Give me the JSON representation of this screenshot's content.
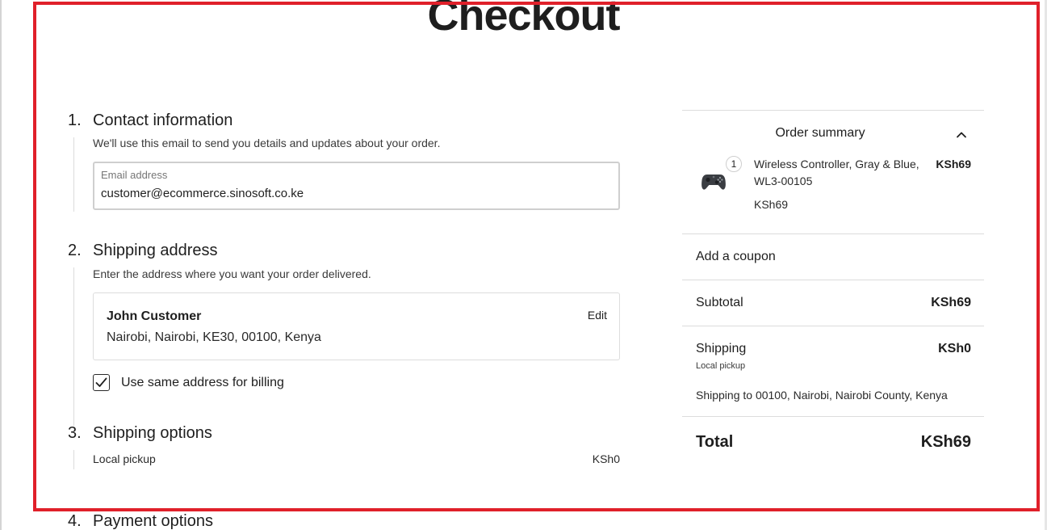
{
  "page": {
    "title": "Checkout"
  },
  "contact": {
    "number": "1.",
    "title": "Contact information",
    "description": "We'll use this email to send you details and updates about your order.",
    "email_label": "Email address",
    "email_value": "customer@ecommerce.sinosoft.co.ke"
  },
  "shipping_address": {
    "number": "2.",
    "title": "Shipping address",
    "description": "Enter the address where you want your order delivered.",
    "name": "John Customer",
    "address": "Nairobi, Nairobi, KE30, 00100, Kenya",
    "edit_label": "Edit",
    "billing_label": "Use same address for billing",
    "billing_checked": true
  },
  "shipping_options": {
    "number": "3.",
    "title": "Shipping options",
    "option_label": "Local pickup",
    "option_price": "KSh0"
  },
  "payment": {
    "number": "4.",
    "title": "Payment options"
  },
  "summary": {
    "title": "Order summary",
    "item": {
      "quantity": "1",
      "name": "Wireless Controller, Gray & Blue, WL3-00105",
      "total": "KSh69",
      "unit_price": "KSh69",
      "icon": "gamepad-icon"
    },
    "coupon_label": "Add a coupon",
    "subtotal_label": "Subtotal",
    "subtotal_value": "KSh69",
    "shipping_label": "Shipping",
    "shipping_value": "KSh0",
    "shipping_method": "Local pickup",
    "shipping_to": "Shipping to 00100, Nairobi, Nairobi County, Kenya",
    "total_label": "Total",
    "total_value": "KSh69"
  },
  "colors": {
    "highlight": "#e0202a",
    "text": "#1e1e1e",
    "border": "#dcdcdc"
  }
}
